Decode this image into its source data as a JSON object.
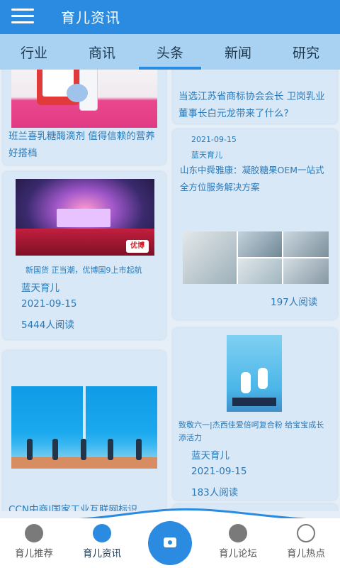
{
  "header": {
    "title": "育儿资讯"
  },
  "tabs": [
    "行业",
    "商讯",
    "头条",
    "新闻",
    "研究"
  ],
  "active_tab": "头条",
  "cards": {
    "lactase": {
      "title": "班兰喜乳糖酶滴剂 值得信赖的营养好搭档"
    },
    "top_right": {
      "title": "当选江苏省商标协会会长 卫岗乳业董事长白元龙带来了什么?"
    },
    "stage": {
      "caption": "新国货 正当潮，优博国9上市起航",
      "author": "蓝天育儿",
      "date": "2021-09-15",
      "reads": "5444人阅读",
      "logo_text": "优博"
    },
    "gel": {
      "date": "2021-09-15",
      "author": "蓝天育儿",
      "title": "山东中舜雅康：凝胶糖果OEM一站式全方位服务解决方案",
      "reads": "197人阅读"
    },
    "tech": {
      "title": "CCN中商|国家工业互联网标识..."
    },
    "poster": {
      "caption": "致敬六一|杰西佳爱倍呵复合粉 给宝宝成长添活力",
      "author": "蓝天育儿",
      "date": "2021-09-15",
      "reads": "183人阅读"
    }
  },
  "bottom_nav": [
    {
      "label": "育儿推荐",
      "icon": "recommend-icon"
    },
    {
      "label": "育儿资讯",
      "icon": "megaphone-icon"
    },
    {
      "label": "",
      "icon": "camera-icon"
    },
    {
      "label": "育儿论坛",
      "icon": "forum-icon"
    },
    {
      "label": "育儿热点",
      "icon": "broadcast-icon"
    }
  ],
  "colors": {
    "primary": "#2b8be0",
    "tab_bar": "#a9d2f2",
    "card_bg": "#d8e8f7",
    "text_link": "#2a7ab8"
  }
}
